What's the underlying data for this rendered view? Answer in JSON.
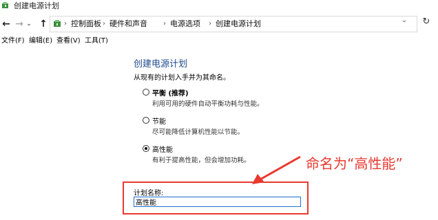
{
  "window": {
    "title": "创建电源计划"
  },
  "address": {
    "crumbs": [
      "控制面板",
      "硬件和声音",
      "电源选项",
      "创建电源计划"
    ],
    "separator": "›"
  },
  "nav": {
    "back": "←",
    "forward": "→",
    "recent": "⌄",
    "up": "↑",
    "dropdown": "⌄",
    "refresh": "↻"
  },
  "menu": {
    "items": [
      "文件(F)",
      "编辑(E)",
      "查看(V)",
      "工具(T)"
    ]
  },
  "main": {
    "heading": "创建电源计划",
    "subtitle": "从现有的计划入手并为其命名。",
    "options": [
      {
        "label": "平衡 (推荐)",
        "desc": "利用可用的硬件自动平衡功耗与性能。",
        "checked": false
      },
      {
        "label": "节能",
        "desc": "尽可能降低计算机性能以节能。",
        "checked": false
      },
      {
        "label": "高性能",
        "desc": "有利于提高性能，但会增加功耗。",
        "checked": true
      }
    ],
    "plan_name_label": "计划名称:",
    "plan_name_value": "高性能"
  },
  "annotation": {
    "text": "命名为“高性能”",
    "color": "#e8392f"
  },
  "colors": {
    "heading": "#1e4a8c",
    "input_border": "#1c6fd1"
  }
}
